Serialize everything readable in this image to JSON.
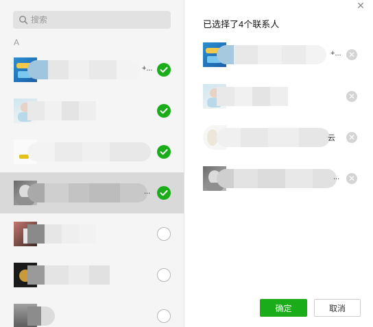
{
  "search": {
    "placeholder": "搜索"
  },
  "contacts": {
    "section_letter": "A",
    "items": [
      {
        "tail": "+...",
        "checked": true
      },
      {
        "tail": "",
        "checked": true
      },
      {
        "tail": "",
        "checked": true
      },
      {
        "tail": "...",
        "checked": true
      },
      {
        "tail": "",
        "checked": false
      },
      {
        "tail": "",
        "checked": false
      },
      {
        "tail": "",
        "checked": false
      }
    ]
  },
  "selected_panel": {
    "title": "已选择了4个联系人",
    "items": [
      {
        "tail": "+..."
      },
      {
        "tail": ""
      },
      {
        "tail": "云"
      },
      {
        "tail": "..."
      }
    ]
  },
  "buttons": {
    "ok": "确定",
    "cancel": "取消"
  },
  "icons": {
    "search": "search-icon",
    "close": "close-icon",
    "check": "check-icon",
    "remove": "remove-icon"
  },
  "colors": {
    "accent": "#1aad19",
    "sidebar_bg": "#f5f5f5",
    "selected_row": "#d9d9d9"
  }
}
